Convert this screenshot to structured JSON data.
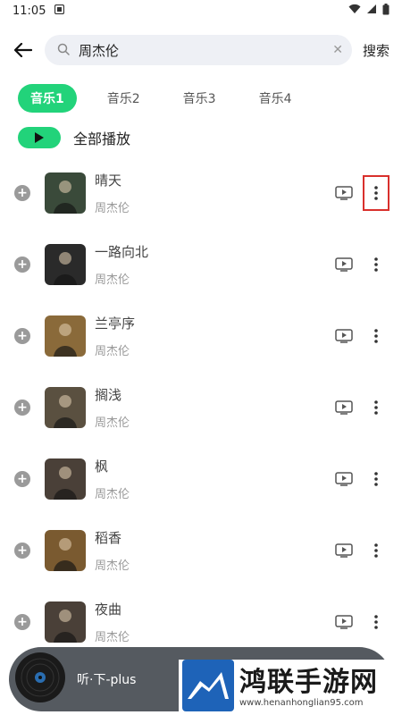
{
  "status_bar": {
    "time": "11:05"
  },
  "search": {
    "query": "周杰伦",
    "button_label": "搜索"
  },
  "tabs": [
    {
      "label": "音乐1",
      "active": true
    },
    {
      "label": "音乐2",
      "active": false
    },
    {
      "label": "音乐3",
      "active": false
    },
    {
      "label": "音乐4",
      "active": false
    }
  ],
  "play_all": {
    "label": "全部播放"
  },
  "songs": [
    {
      "title": "晴天",
      "artist": "周杰伦",
      "cover_color": "#3a4a3a"
    },
    {
      "title": "一路向北",
      "artist": "周杰伦",
      "cover_color": "#2a2a2a"
    },
    {
      "title": "兰亭序",
      "artist": "周杰伦",
      "cover_color": "#8a6a3a"
    },
    {
      "title": "搁浅",
      "artist": "周杰伦",
      "cover_color": "#5a5040"
    },
    {
      "title": "枫",
      "artist": "周杰伦",
      "cover_color": "#4a4038"
    },
    {
      "title": "稻香",
      "artist": "周杰伦",
      "cover_color": "#7a5a30"
    },
    {
      "title": "夜曲",
      "artist": "周杰伦",
      "cover_color": "#4a4038"
    }
  ],
  "mini_player": {
    "label": "听·下-plus"
  },
  "watermark": {
    "title": "鸿联手游网",
    "url": "www.henanhonglian95.com"
  },
  "colors": {
    "accent": "#22d37a",
    "highlight": "#d9302c"
  }
}
